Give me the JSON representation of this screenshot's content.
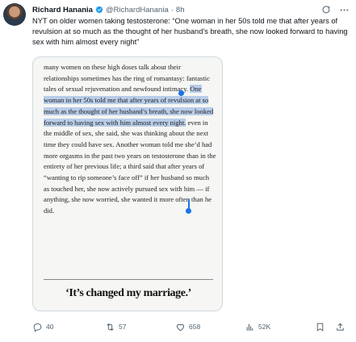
{
  "author": {
    "name": "Richard Hanania",
    "handle": "@RichardHanania",
    "separator": "·",
    "time": "8h"
  },
  "tweet": {
    "text": "NYT on older women taking testosterone: “One woman in her 50s told me that after years of revulsion at so much as the thought of her husband’s breath, she now looked forward to having sex with him almost every night”"
  },
  "article": {
    "before": "many women on these high doses talk about their relationships sometimes has the ring of romantasy: fantastic tales of sexual rejuvenation and newfound intimacy. ",
    "highlight": "One woman in her 50s told me that after years of revulsion at so much as the thought of her husband’s breath, she now looked forward to having sex with him almost every night.",
    "after": " even in the middle of sex, she said, she was thinking about the next time they could have sex. Another woman told me she’d had more orgasms in the past two years on testosterone than in the entirety of her previous life; a third said that after years of “wanting to rip someone’s face off” if her husband so much as touched her, she now actively pursued sex with him — if anything, she now worried, she wanted it more often than he did.",
    "pull_quote": "‘It’s changed my marriage.’"
  },
  "actions": {
    "replies": "40",
    "reposts": "57",
    "likes": "658",
    "views": "52K"
  },
  "icons": [
    "verified-badge-icon",
    "grok-icon",
    "more-icon",
    "reply-icon",
    "retweet-icon",
    "like-icon",
    "views-icon",
    "bookmark-icon",
    "share-icon"
  ],
  "colors": {
    "verified": "#1d9bf0",
    "text": "#0f1419",
    "secondary": "#536471",
    "selection": "#b9cde9"
  }
}
